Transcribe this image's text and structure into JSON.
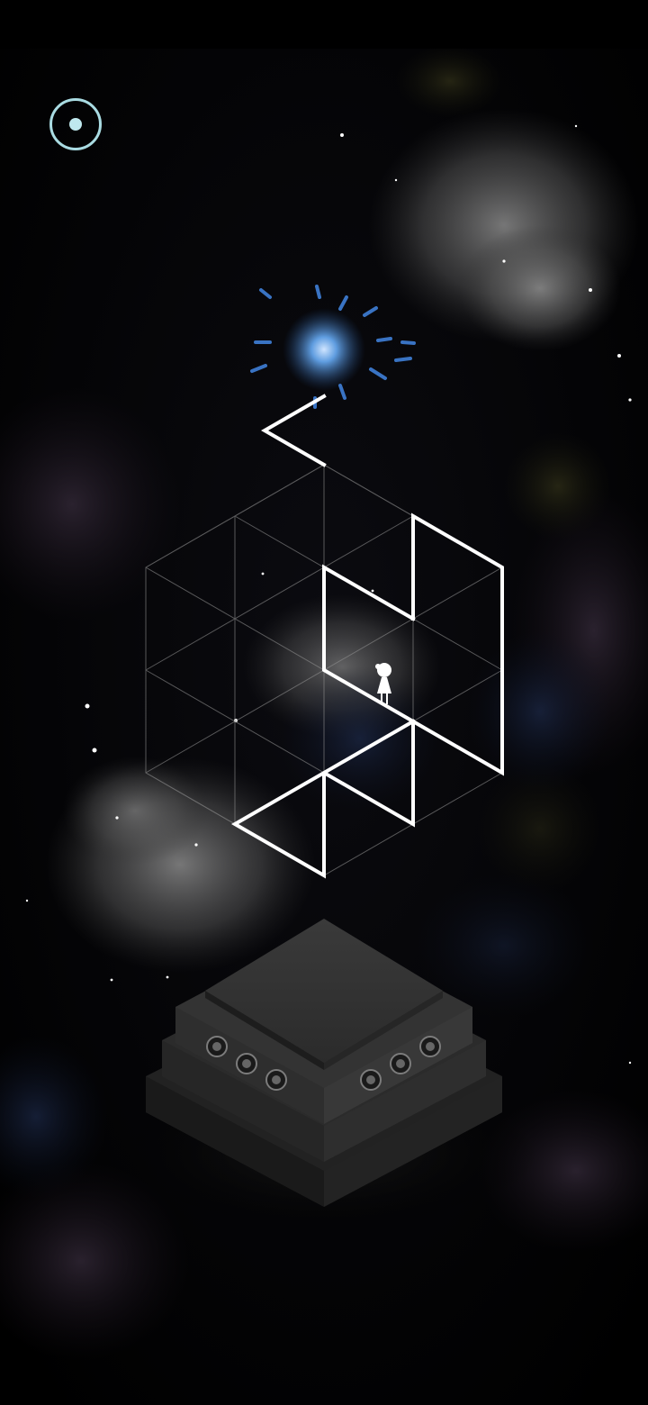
{
  "game": {
    "screen": "puzzle-level",
    "setting": "night sky",
    "colors": {
      "background": "#000000",
      "path_line": "#ffffff",
      "grid_line": "#8f8f8f",
      "menu_ring": "#a9dbe2",
      "goal_glow": "#4f8fd6",
      "pedestal": "#2a2a2a"
    }
  },
  "hud": {
    "menu_button": {
      "icon": "menu-ring-icon"
    }
  },
  "icons": {
    "goal": "star-glow-icon",
    "player": "girl-figure-icon",
    "pedestal": "stone-pedestal-icon"
  }
}
